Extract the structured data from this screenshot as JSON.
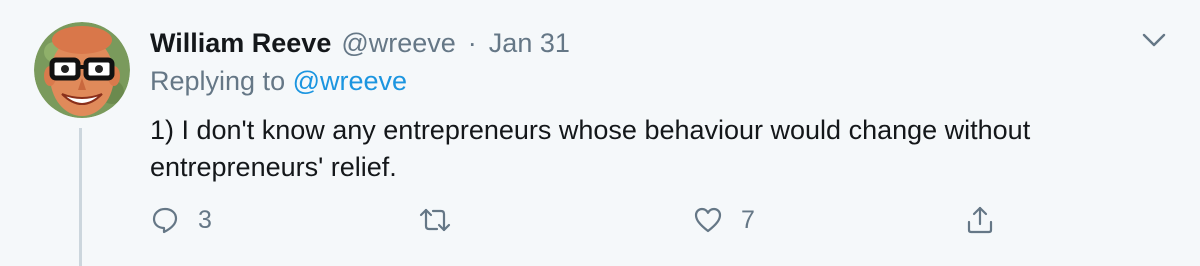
{
  "tweet": {
    "author_name": "William Reeve",
    "handle": "@wreeve",
    "separator": "·",
    "date": "Jan 31",
    "replying_prefix": "Replying to",
    "replying_to": "@wreeve",
    "text": "1) I don't know any entrepreneurs whose behaviour would change without entrepreneurs' relief."
  },
  "actions": {
    "reply_count": "3",
    "retweet_count": "",
    "like_count": "7"
  },
  "icons": {
    "reply": "reply-icon",
    "retweet": "retweet-icon",
    "like": "heart-icon",
    "share": "share-icon",
    "more": "chevron-down-icon"
  },
  "colors": {
    "background": "#f5f8fa",
    "primary_text": "#14171a",
    "secondary_text": "#657786",
    "link": "#1b95e0",
    "thread_line": "#ccd6dd"
  }
}
